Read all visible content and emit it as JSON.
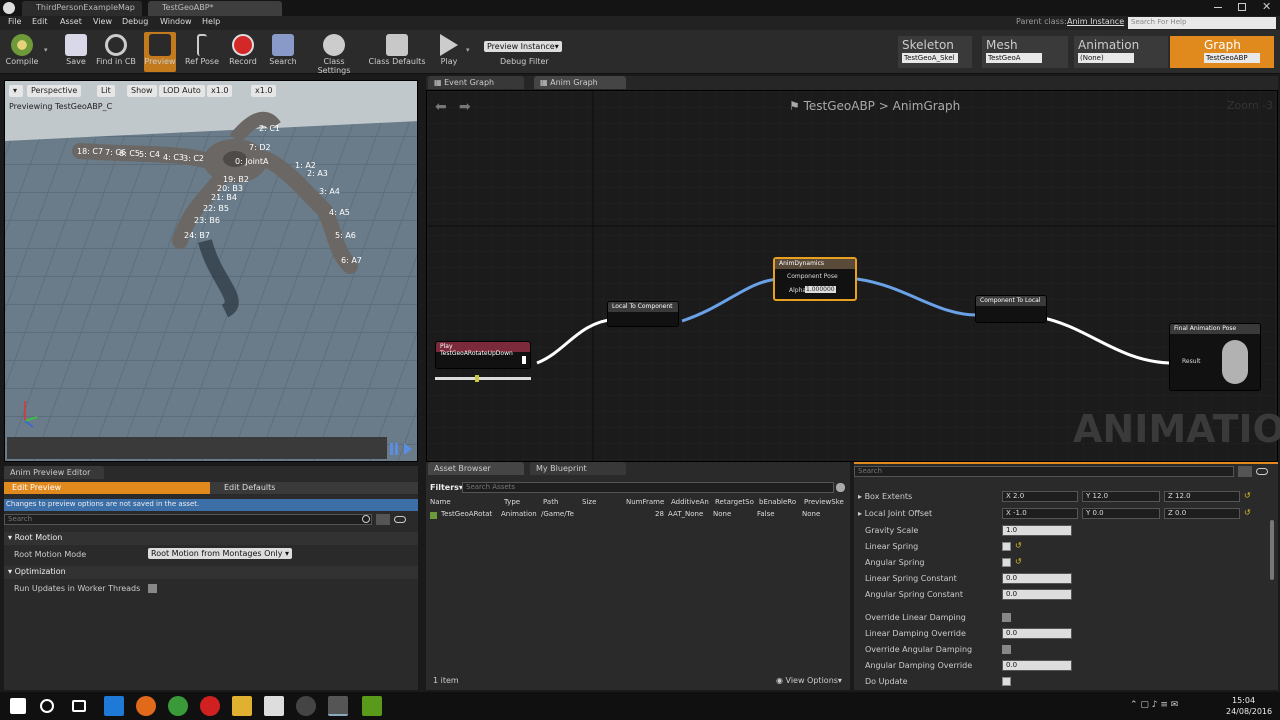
{
  "window": {
    "tabs": [
      "ThirdPersonExampleMap",
      "TestGeoABP*"
    ]
  },
  "menubar": {
    "items": [
      "File",
      "Edit",
      "Asset",
      "View",
      "Debug",
      "Window",
      "Help"
    ],
    "parent_class_label": "Parent class:",
    "parent_class": "Anim Instance",
    "search_placeholder": "Search For Help"
  },
  "toolbar": {
    "buttons": [
      "Compile",
      "Save",
      "Find in CB",
      "Preview",
      "Ref Pose",
      "Record",
      "Search",
      "Class Settings",
      "Class Defaults",
      "Play"
    ],
    "preview_instance": "Preview Instance▾",
    "debug_filter": "Debug Filter"
  },
  "modes": [
    {
      "title": "Skeleton",
      "field": "TestGeoA_Skel"
    },
    {
      "title": "Mesh",
      "field": "TestGeoA"
    },
    {
      "title": "Animation",
      "field": "(None)"
    },
    {
      "title": "Graph",
      "field": "TestGeoABP"
    }
  ],
  "viewport": {
    "buttons": [
      "Perspective",
      "Lit",
      "Show",
      "LOD Auto",
      "x1.0",
      "x1.0"
    ],
    "previewing": "Previewing TestGeoABP_C",
    "bones": [
      "18: C7",
      "7: C6",
      "6: C5",
      "5: C4",
      "4: C3",
      "3: C2",
      "2: C1",
      "0: JointA",
      "1: A2",
      "2: A3",
      "3: A4",
      "4: A5",
      "5: A6",
      "6: A7",
      "19: B2",
      "20: B3",
      "21: B4",
      "22: B5",
      "23: B6",
      "24: B7",
      "7: D2"
    ]
  },
  "preview_editor": {
    "tab": "Anim Preview Editor",
    "edit_preview": "Edit Preview",
    "edit_defaults": "Edit Defaults",
    "notice": "Changes to preview options are not saved in the asset.",
    "search": "Search",
    "root_motion": "Root Motion",
    "root_motion_mode_label": "Root Motion Mode",
    "root_motion_mode": "Root Motion from Montages Only ▾",
    "optimization": "Optimization",
    "run_updates": "Run Updates in Worker Threads"
  },
  "graph": {
    "tabs": [
      "Event Graph",
      "Anim Graph"
    ],
    "breadcrumb": [
      "TestGeoABP",
      "AnimGraph"
    ],
    "zoom": "Zoom -3",
    "watermark": "ANIMATION",
    "nodes": {
      "play": "Play TestGeoARotateUpDown",
      "l2c": "Local To Component",
      "dyn": "AnimDynamics",
      "dyn_pin": "Component Pose",
      "alpha_label": "Alpha",
      "alpha": "1.000000",
      "c2l": "Component To Local",
      "final": "Final Animation Pose",
      "result": "Result"
    }
  },
  "asset_browser": {
    "tabs": [
      "Asset Browser",
      "My Blueprint"
    ],
    "filters": "Filters▾",
    "search": "Search Assets",
    "columns": [
      "Name",
      "Type",
      "Path",
      "Size",
      "NumFrame",
      "AdditiveAn",
      "RetargetSo",
      "bEnableRo",
      "PreviewSke"
    ],
    "rows": [
      [
        "TestGeoARotat",
        "Animation",
        "/Game/Te",
        "",
        "28",
        "AAT_None",
        "None",
        "False",
        "None"
      ]
    ],
    "count": "1 item",
    "view_options": "View Options▾"
  },
  "details": {
    "search": "Search",
    "props": [
      {
        "label": "Box Extents",
        "x": "X  2.0",
        "y": "Y  12.0",
        "z": "Z  12.0"
      },
      {
        "label": "Local Joint Offset",
        "x": "X  -1.0",
        "y": "Y  0.0",
        "z": "Z  0.0"
      },
      {
        "label": "Gravity Scale",
        "v": "1.0"
      },
      {
        "label": "Linear Spring"
      },
      {
        "label": "Angular Spring"
      },
      {
        "label": "Linear Spring Constant",
        "v": "0.0"
      },
      {
        "label": "Angular Spring Constant",
        "v": "0.0"
      },
      {
        "label": "Override Linear Damping"
      },
      {
        "label": "Linear Damping Override",
        "v": "0.0"
      },
      {
        "label": "Override Angular Damping"
      },
      {
        "label": "Angular Damping Override",
        "v": "0.0"
      },
      {
        "label": "Do Update"
      }
    ]
  },
  "taskbar": {
    "time": "15:04",
    "date": "24/08/2016"
  }
}
